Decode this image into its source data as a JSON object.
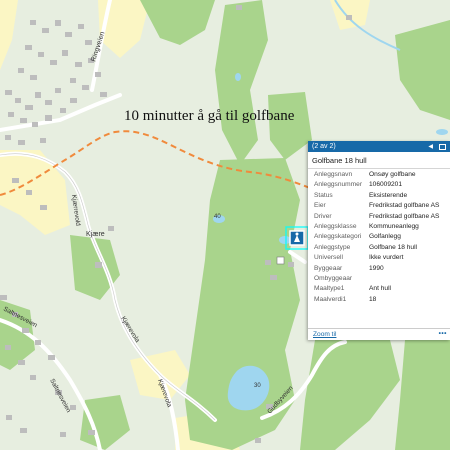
{
  "annotation": "10 minutter å gå til golfbane",
  "popup": {
    "pager": "(2 av 2)",
    "title": "Golfbane 18 hull",
    "rows": [
      {
        "key": "Anleggsnavn",
        "value": "Onsøy golfbane"
      },
      {
        "key": "Anleggsnummer",
        "value": "106009201"
      },
      {
        "key": "Status",
        "value": "Eksisterende"
      },
      {
        "key": "Eier",
        "value": "Fredrikstad golfbane AS"
      },
      {
        "key": "Driver",
        "value": "Fredrikstad golfbane AS"
      },
      {
        "key": "Anleggsklasse",
        "value": "Kommuneanlegg"
      },
      {
        "key": "Anleggskategori",
        "value": "Golfanlegg"
      },
      {
        "key": "Anleggstype",
        "value": "Golfbane 18 hull"
      },
      {
        "key": "Universell",
        "value": "Ikke vurdert"
      },
      {
        "key": "Byggeaar",
        "value": "1990"
      },
      {
        "key": "Ombyggeaar",
        "value": ""
      },
      {
        "key": "Maaltype1",
        "value": "Ant hull"
      },
      {
        "key": "Maalverdi1",
        "value": "18"
      }
    ],
    "zoom_label": "Zoom til",
    "more_label": "•••",
    "prev_icon": "◀",
    "max_icon": "maximize-icon"
  },
  "map_labels": {
    "ringveien": "Ringveien",
    "kjerrevold": "Kjærrevold",
    "kjaere": "Kjære",
    "kjaere_road": "Kjærevola",
    "kjaere_road2": "Kjærevola",
    "saltnesveien": "Saltnesveien",
    "saltnesveien2": "Saltnesveien",
    "gudbyveien": "Gudbyveien",
    "elev40": "40",
    "elev30": "30"
  },
  "colors": {
    "forest": "#a9d48c",
    "open": "#e7eee0",
    "field": "#fbf6c4",
    "water": "#9fd6ef",
    "road": "#ffffff",
    "route": "#f08a3c",
    "header": "#1769a8"
  }
}
